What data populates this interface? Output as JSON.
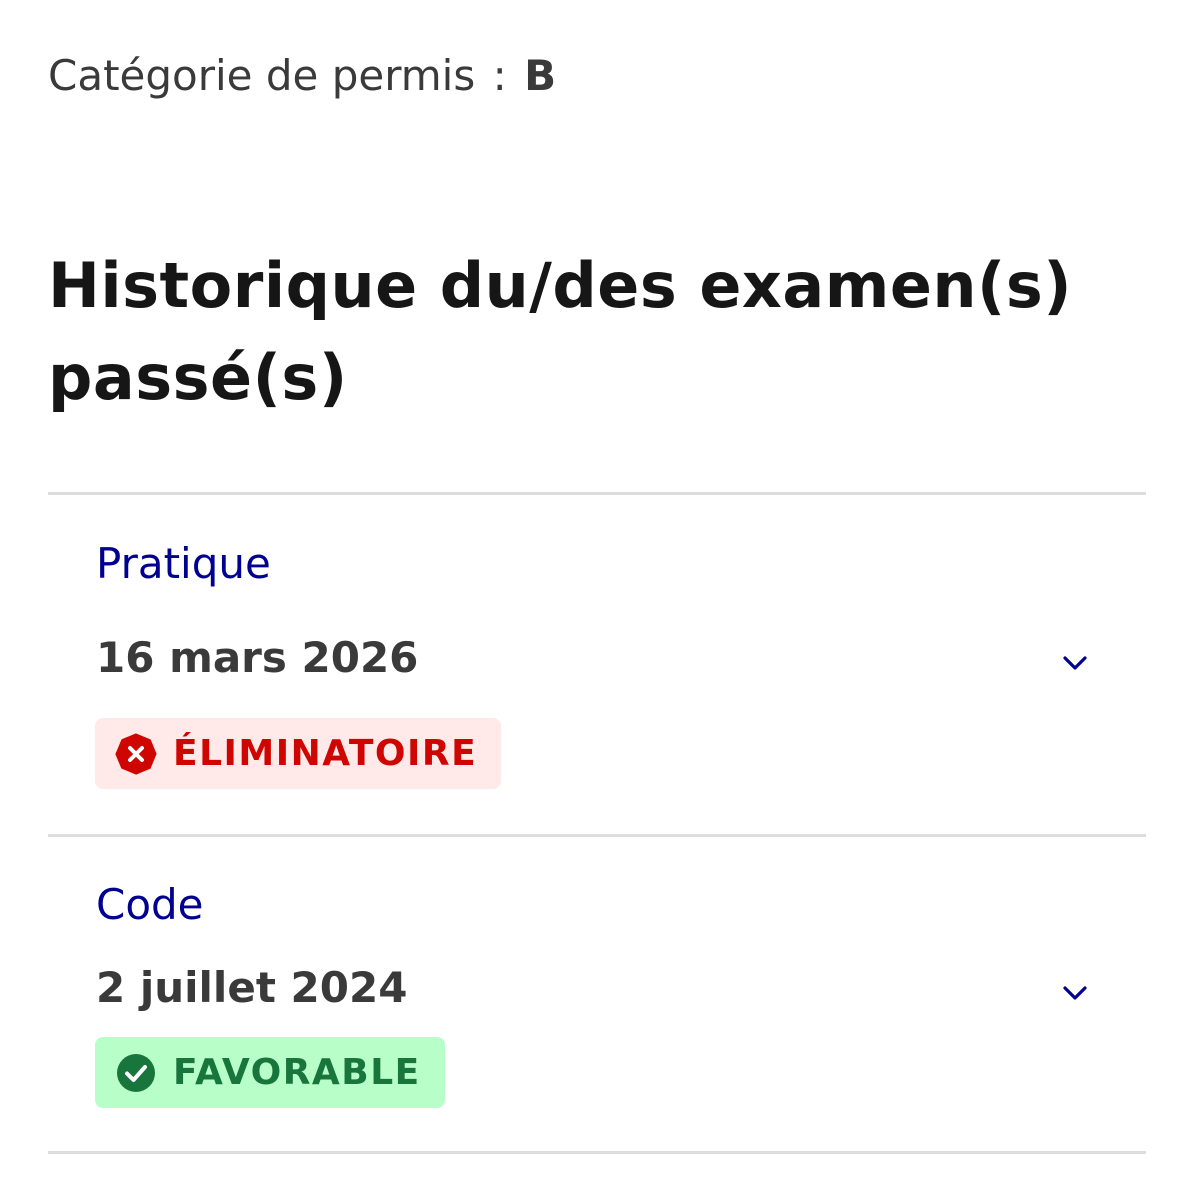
{
  "permit": {
    "label": "Catégorie de permis",
    "separator": ":",
    "value": "B"
  },
  "section": {
    "title": "Historique du/des examen(s) passé(s)"
  },
  "exams": [
    {
      "type": "Pratique",
      "date": "16 mars 2026",
      "result": "ÉLIMINATOIRE",
      "result_status": "error",
      "result_icon": "error-octagon-icon",
      "result_color": "#ce0500",
      "result_background": "#ffe9e9",
      "toggle_icon": "chevron-down-icon"
    },
    {
      "type": "Code",
      "date": "2 juillet 2024",
      "result": "FAVORABLE",
      "result_status": "success",
      "result_icon": "check-circle-icon",
      "result_color": "#18753c",
      "result_background": "#b8fec9",
      "toggle_icon": "chevron-down-icon"
    }
  ],
  "theme": {
    "accent": "#000091",
    "text": "#3a3a3a",
    "heading": "#161616",
    "divider": "#dddddd"
  }
}
